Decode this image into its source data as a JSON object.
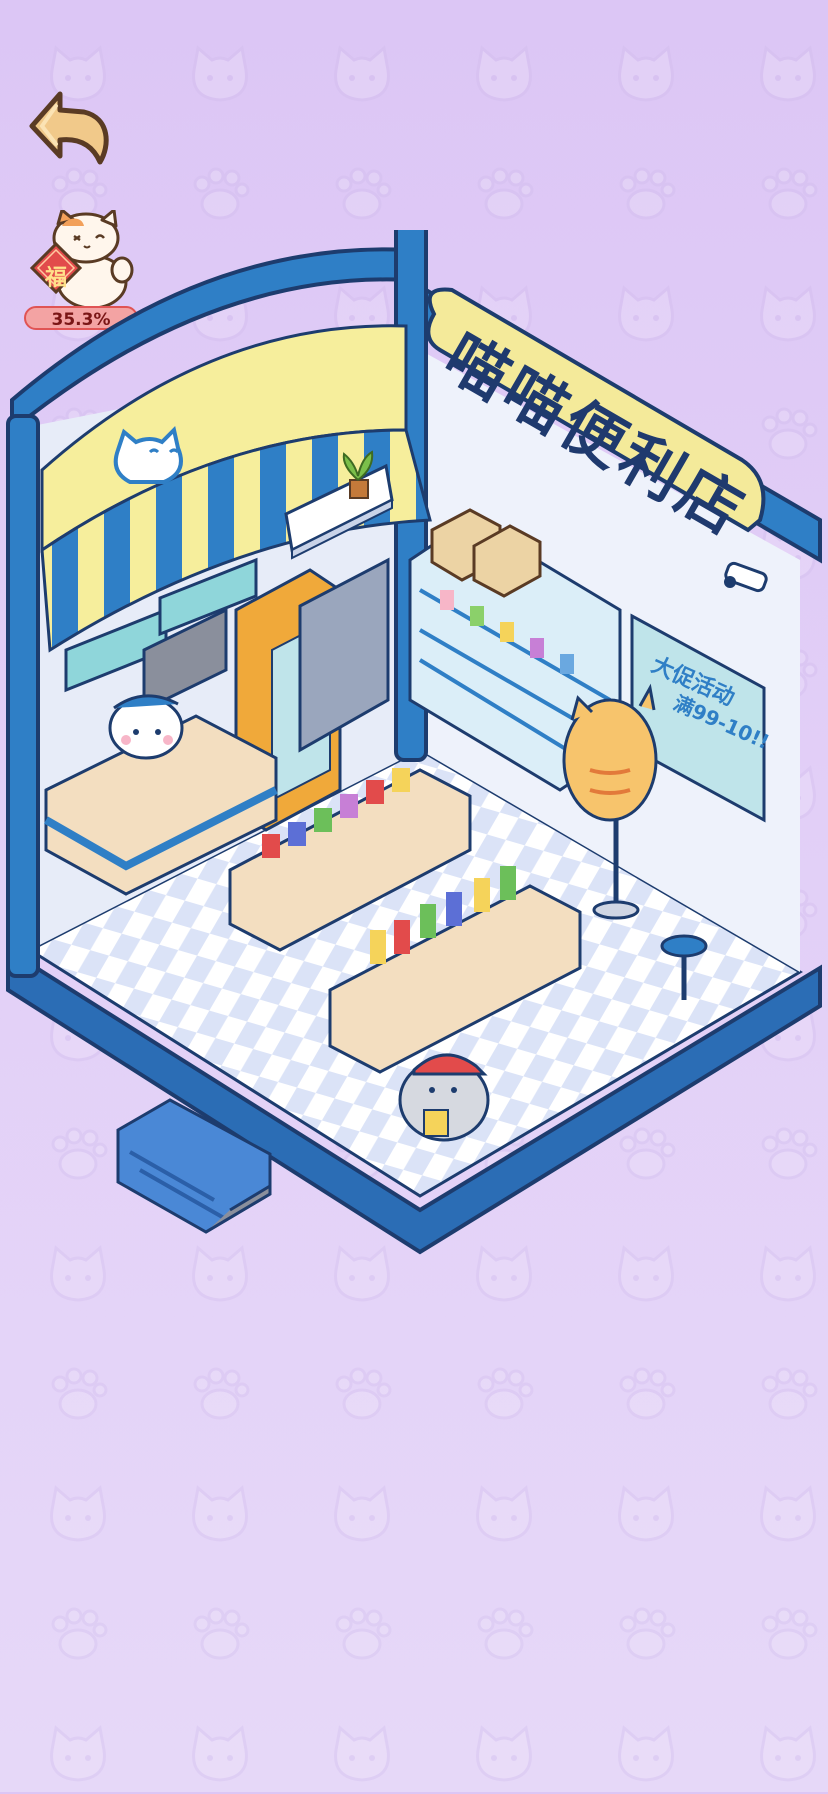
{
  "hud": {
    "back_icon": "back-arrow-icon",
    "lucky_cat": {
      "badge_char": "福",
      "progress_text": "35.3%",
      "progress": 0.353
    }
  },
  "shop": {
    "sign_text": "喵喵便利店",
    "poster_line1": "大促活动",
    "poster_line2": "满99-10!!"
  },
  "colors": {
    "background": "#dcc6f5",
    "shop_blue": "#2f7fc6",
    "awning_yellow": "#f6ee9c",
    "sign_yellow": "#f4ea9a",
    "badge_red": "#e24b4b"
  }
}
